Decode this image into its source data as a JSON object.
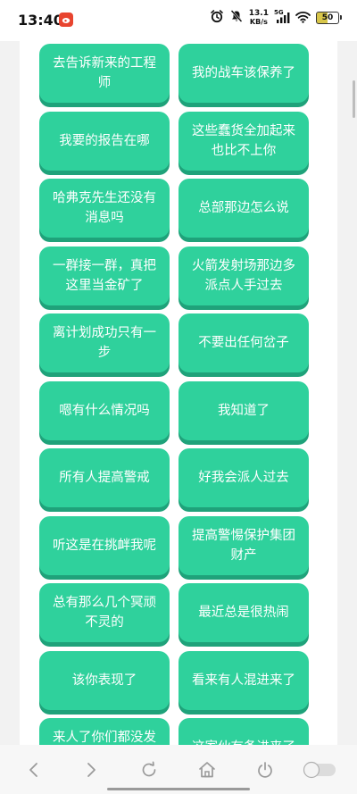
{
  "status": {
    "time": "13:40",
    "net_speed_value": "13.1",
    "net_speed_unit": "KB/s",
    "signal_label": "5G",
    "battery": "50"
  },
  "phrases": [
    "去告诉新来的工程师",
    "我的战车该保养了",
    "我要的报告在哪",
    "这些蠢货全加起来也比不上你",
    "哈弗克先生还没有消息吗",
    "总部那边怎么说",
    "一群接一群，真把这里当金矿了",
    "火箭发射场那边多派点人手过去",
    "离计划成功只有一步",
    "不要出任何岔子",
    "嗯有什么情况吗",
    "我知道了",
    "所有人提高警戒",
    "好我会派人过去",
    "听这是在挑衅我呢",
    "提高警惕保护集团财产",
    "总有那么几个冥顽不灵的",
    "最近总是很热闹",
    "该你表现了",
    "看来有人混进来了",
    "来人了你们都没发现吗",
    "这家伙有备进来了"
  ],
  "colors": {
    "button": "#2fd19c",
    "button_shadow": "#1fa27a"
  },
  "icons": [
    "weibo-icon",
    "alarm-icon",
    "mute-icon",
    "signal-icon",
    "wifi-icon",
    "battery-icon",
    "back-icon",
    "forward-icon",
    "reload-icon",
    "home-icon",
    "power-icon",
    "toggle-icon"
  ]
}
